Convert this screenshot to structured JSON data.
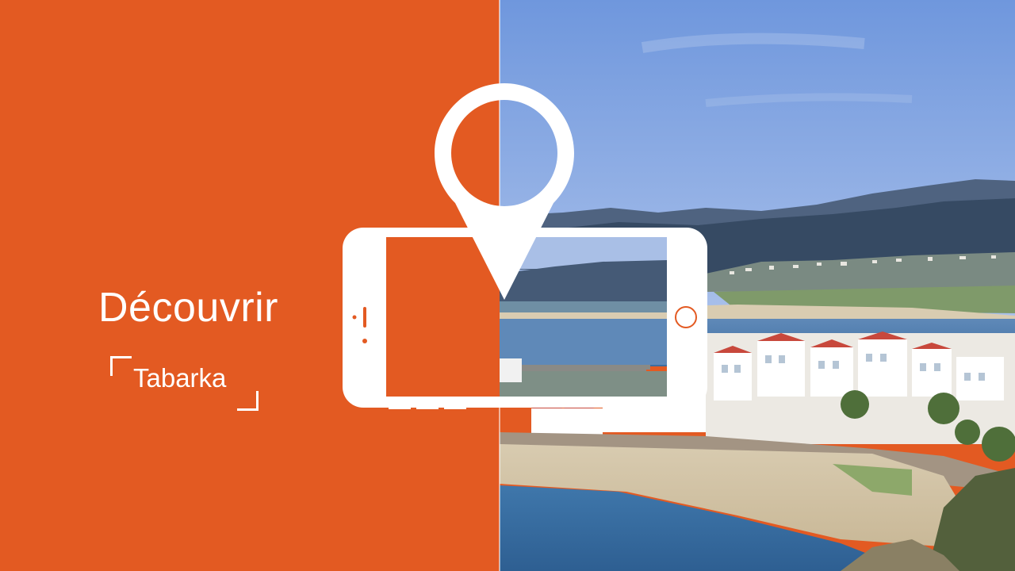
{
  "slide": {
    "headline": "Découvrir",
    "place": "Tabarka"
  },
  "colors": {
    "accent": "#e35a22",
    "foreground": "#ffffff",
    "sky_top": "#6f97dd",
    "sea": "#3e6fa2"
  },
  "icons": {
    "pin": "map-pin-icon",
    "phone": "smartphone-landscape-icon"
  },
  "photo_subject": "coastal town with beach, harbor, sea and hills"
}
